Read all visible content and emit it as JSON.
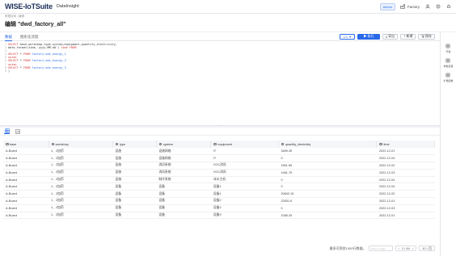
{
  "app": {
    "brand": "WISE-IoTSuite",
    "subtitle": "DataInsight",
    "role_badge": "Admin",
    "factory": "Factory"
  },
  "header": {
    "breadcrumb": "数据探索 / 编辑",
    "title": "编辑 \"dwd_factory_all\""
  },
  "tabs": [
    {
      "label": "数据"
    },
    {
      "label": "图形化流程"
    }
  ],
  "toolbar": {
    "page_indicator": "1/1 ▼",
    "run_label": "▶ 执行",
    "export_label": "⤓ 导出",
    "new_label": "+ 新建",
    "save_label": "🖫 保存"
  },
  "editor": {
    "lines": [
      {
        "n": "1",
        "parts": [
          {
            "t": "kw",
            "v": "SELECT "
          },
          {
            "t": "",
            "v": "base,workshop,type,system,equipment,quantity_electricity,"
          }
        ]
      },
      {
        "n": "2",
        "parts": [
          {
            "t": "",
            "v": "date_format(time,'yyyy-MM-dd') "
          },
          {
            "t": "kw",
            "v": "time "
          },
          {
            "t": "kw",
            "v": "FROM"
          }
        ]
      },
      {
        "n": "3",
        "parts": []
      },
      {
        "n": "4",
        "parts": [
          {
            "t": "kw",
            "v": "SELECT "
          },
          {
            "t": "",
            "v": "* "
          },
          {
            "t": "kw",
            "v": "FROM "
          },
          {
            "t": "ident",
            "v": "factory.ods_energy_1"
          }
        ]
      },
      {
        "n": "5",
        "parts": [
          {
            "t": "kw",
            "v": "union"
          }
        ]
      },
      {
        "n": "6",
        "parts": [
          {
            "t": "kw",
            "v": "SELECT "
          },
          {
            "t": "",
            "v": "* "
          },
          {
            "t": "kw",
            "v": "FROM "
          },
          {
            "t": "ident",
            "v": "factory.ods_energy_2"
          }
        ]
      },
      {
        "n": "7",
        "parts": [
          {
            "t": "kw",
            "v": "union"
          }
        ]
      },
      {
        "n": "8",
        "parts": [
          {
            "t": "kw",
            "v": "SELECT "
          },
          {
            "t": "",
            "v": "* "
          },
          {
            "t": "kw",
            "v": "FROM "
          },
          {
            "t": "ident",
            "v": "factory.ods_energy_3"
          }
        ]
      },
      {
        "n": "9",
        "parts": [
          {
            "t": "",
            "v": ")"
          }
        ]
      }
    ]
  },
  "right_panel": [
    {
      "label": "开发",
      "icon": "code-icon"
    },
    {
      "label": "参数变量",
      "icon": "variable-icon"
    },
    {
      "label": "扩展函数",
      "icon": "function-icon"
    }
  ],
  "result": {
    "columns": [
      "base",
      "workshop",
      "type",
      "system",
      "equipment",
      "quantity_electricity",
      "time"
    ],
    "rows": [
      [
        "A-Board",
        "1、2加药",
        "设施",
        "设施网络",
        "IT",
        "3489.35",
        "2022-12-01"
      ],
      [
        "A-Board",
        "1、2加药",
        "设施",
        "设施网络",
        "IT",
        "0",
        "2022-12-04"
      ],
      [
        "A-Board",
        "1、2加药",
        "设施",
        "消风系统",
        "VOC消风",
        "1551.65",
        "2022-12-02"
      ],
      [
        "A-Board",
        "1、2加药",
        "设施",
        "消风系统",
        "VOC消风",
        "1481.75",
        "2022-12-03"
      ],
      [
        "A-Board",
        "1、2加药",
        "设施",
        "制冷系统",
        "冰水主机",
        "0",
        "2022-12-04"
      ],
      [
        "A-Board",
        "1、2加药",
        "设备",
        "设备",
        "设备1",
        "0",
        "2022-12-04"
      ],
      [
        "A-Board",
        "1、2加药",
        "设备",
        "设备",
        "设备1",
        "20842.15",
        "2022-12-02"
      ],
      [
        "A-Board",
        "1、2加药",
        "设备",
        "设备",
        "设备2",
        "22831.6",
        "2022-12-01"
      ],
      [
        "A-Board",
        "1、2加药",
        "设备",
        "设备",
        "设备2",
        "0",
        "2022-12-03"
      ],
      [
        "A-Board",
        "1、2加药",
        "设备",
        "设备",
        "设备3",
        "1085.25",
        "2022-12-01"
      ]
    ]
  },
  "pager": {
    "summary": "最多可预览1000行数据。",
    "jump_placeholder": "Jump to page",
    "page_text": "1 / 64",
    "page_size": "10 / 页"
  },
  "colors": {
    "accent": "#2a6ae9",
    "keyword": "#d12f2f"
  }
}
